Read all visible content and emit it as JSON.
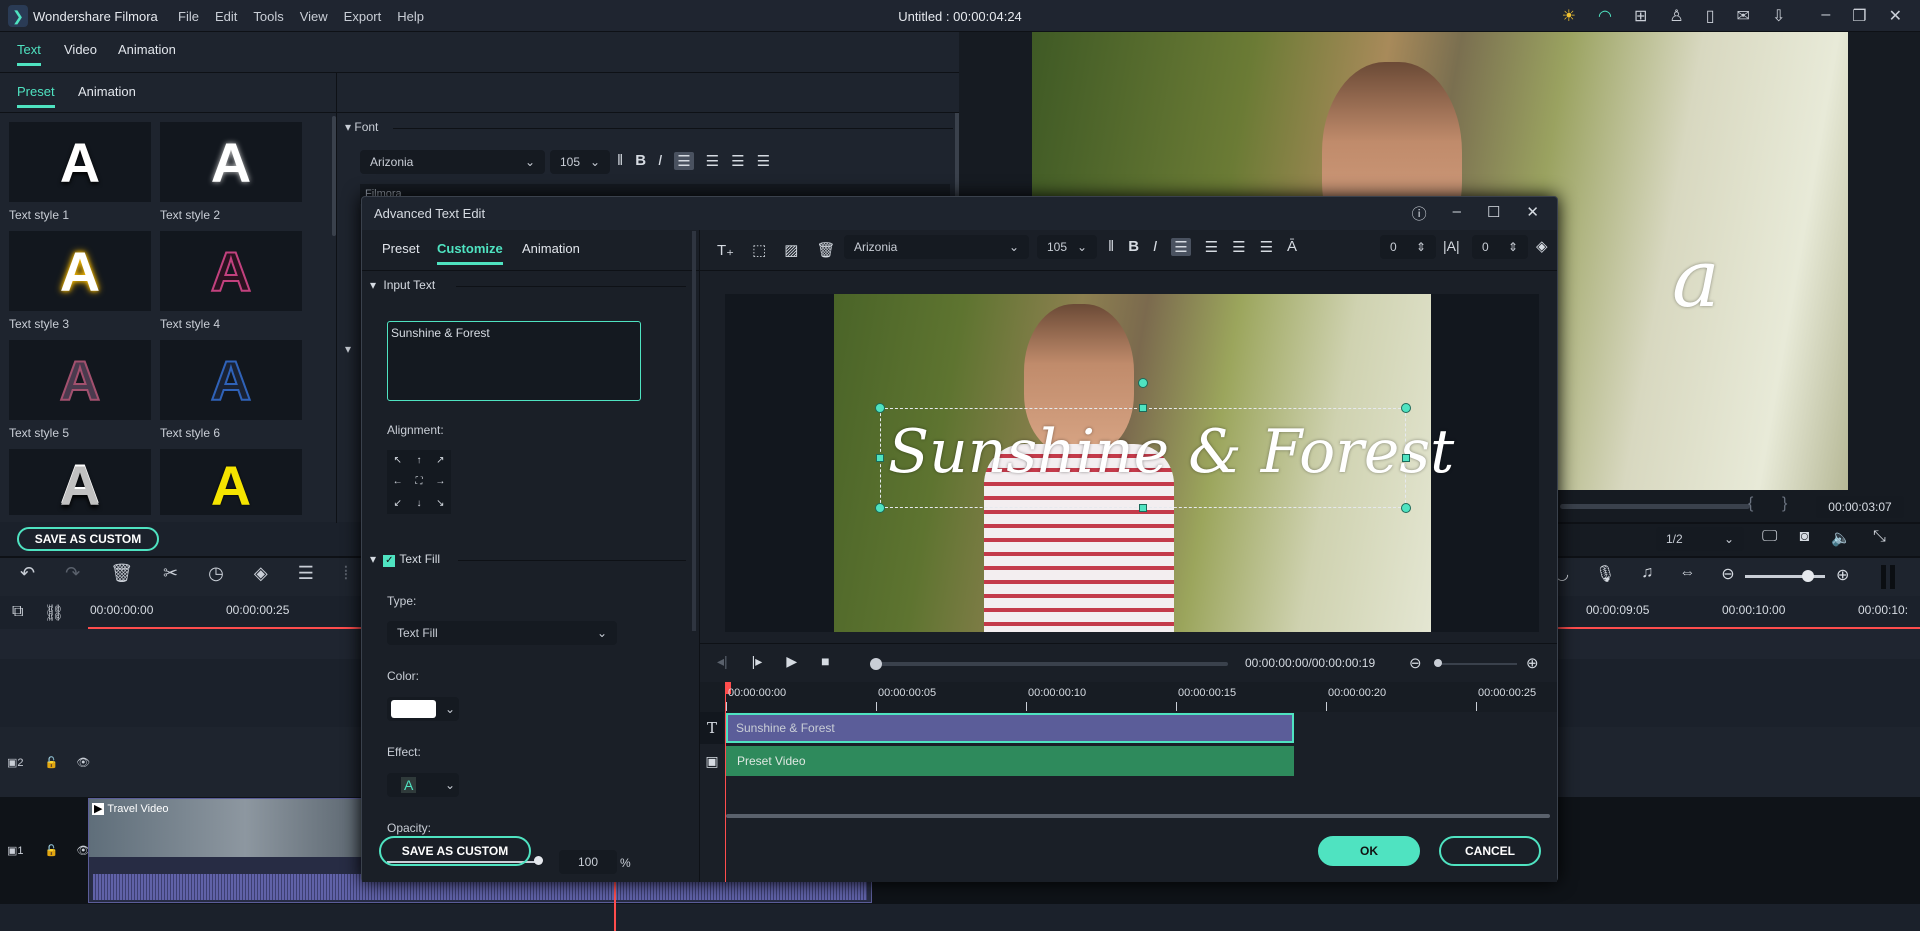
{
  "app": {
    "name": "Wondershare Filmora",
    "title": "Untitled : 00:00:04:24",
    "menu": [
      "File",
      "Edit",
      "Tools",
      "View",
      "Export",
      "Help"
    ]
  },
  "left_panel": {
    "tabs": [
      "Text",
      "Video",
      "Animation"
    ],
    "active_tab": "Text",
    "subtabs": [
      "Preset",
      "Animation"
    ],
    "active_subtab": "Preset",
    "presets": [
      {
        "label": "Text style 1",
        "glyph": "A",
        "color": "#ffffff"
      },
      {
        "label": "Text style 2",
        "glyph": "A",
        "color": "#ffffff"
      },
      {
        "label": "Text style 3",
        "glyph": "A",
        "color": "#ffffff"
      },
      {
        "label": "Text style 4",
        "glyph": "A",
        "color": "#c2417e"
      },
      {
        "label": "Text style 5",
        "glyph": "A",
        "color": "#4a3a4e"
      },
      {
        "label": "Text style 6",
        "glyph": "A",
        "color": "#1f3f7a"
      },
      {
        "label": "",
        "glyph": "A",
        "color": "#bfbfbf"
      },
      {
        "label": "",
        "glyph": "A",
        "color": "#f5e400"
      }
    ],
    "save_custom": "SAVE AS CUSTOM",
    "font_section": {
      "title": "Font",
      "font": "Arizonia",
      "size": "105",
      "sample": "Filmora"
    }
  },
  "preview": {
    "time": "00:00:03:07",
    "quality": "1/2",
    "overlay_text": "a"
  },
  "timeline": {
    "ruler": [
      "00:00:00:00",
      "00:00:00:25",
      "00:00:09:05",
      "00:00:10:00",
      "00:00:10:"
    ],
    "tracks": [
      {
        "num": "2"
      },
      {
        "num": "1",
        "clip": "Travel Video"
      }
    ]
  },
  "dialog": {
    "title": "Advanced Text Edit",
    "tabs": [
      "Preset",
      "Customize",
      "Animation"
    ],
    "active_tab": "Customize",
    "font": "Arizonia",
    "size": "105",
    "char_spacing": "0",
    "line_spacing": "0",
    "input_section": "Input Text",
    "input_text": "Sunshine & Forest",
    "alignment_label": "Alignment:",
    "alignment_arrows": [
      "↖",
      "↑",
      "↗",
      "←",
      "⛶",
      "→",
      "↙",
      "↓",
      "↘"
    ],
    "fill_section": "Text Fill",
    "fill_checked": true,
    "type_label": "Type:",
    "type_value": "Text Fill",
    "color_label": "Color:",
    "color_value": "#ffffff",
    "effect_label": "Effect:",
    "effect_glyph": "A",
    "opacity_label": "Opacity:",
    "opacity": "100",
    "opacity_unit": "%",
    "canvas_text": "Sunshine & Forest",
    "playback_time": "00:00:00:00/00:00:00:19",
    "ruler": [
      "00:00:00:00",
      "00:00:00:05",
      "00:00:00:10",
      "00:00:00:15",
      "00:00:00:20",
      "00:00:00:25"
    ],
    "text_clip": "Sunshine & Forest",
    "video_clip": "Preset Video",
    "save_custom": "SAVE AS CUSTOM",
    "ok": "OK",
    "cancel": "CANCEL"
  },
  "colors": {
    "accent": "#4fe3c1",
    "text_clip": "#5b5d99",
    "video_clip": "#2e8a5c",
    "playhead": "#ff4d4d"
  }
}
